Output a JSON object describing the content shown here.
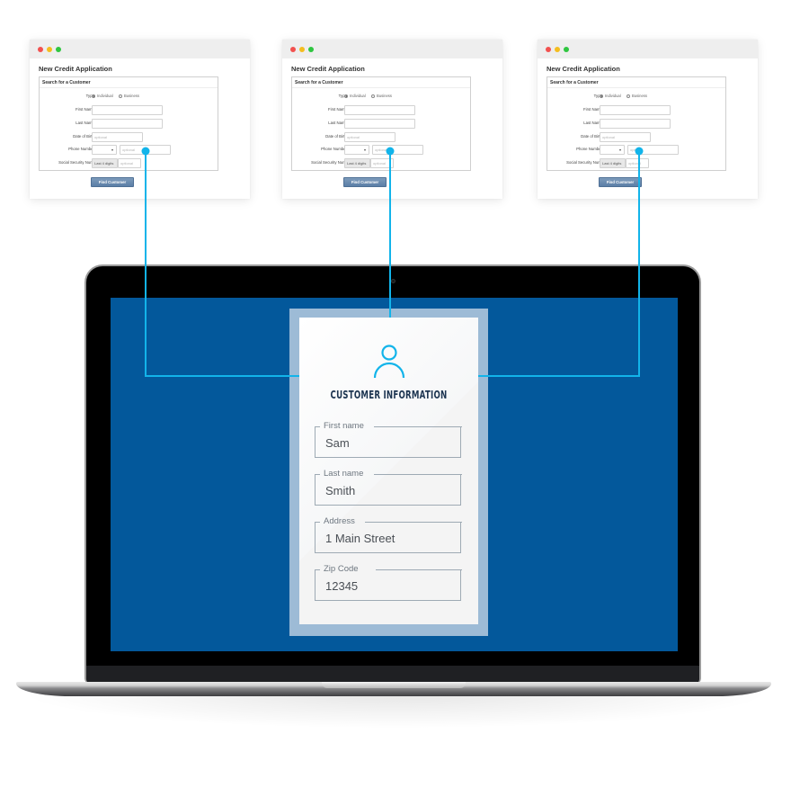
{
  "colors": {
    "accent": "#12b4ea",
    "screen": "#03589b",
    "card_frame": "#9dbbd6",
    "title": "#1c3450"
  },
  "windows": [
    {
      "traffic_lights": [
        "close",
        "minimize",
        "maximize"
      ],
      "title": "New Credit Application",
      "section": "Search for a Customer",
      "type_label": "Type",
      "type_options": [
        "Individual",
        "Business"
      ],
      "type_selected": "Individual",
      "fields": {
        "first_name": "First Name",
        "last_name": "Last Name",
        "dob": "Date of Birth",
        "phone": "Phone Number",
        "ssn": "Social Security Num."
      },
      "placeholders": {
        "dob": "optional",
        "phone": "optional",
        "ssn": "optional"
      },
      "ssn_addon": "Last 4 digits",
      "button": "Find Customer"
    },
    {
      "traffic_lights": [
        "close",
        "minimize",
        "maximize"
      ],
      "title": "New Credit Application",
      "section": "Search for a Customer",
      "type_label": "Type",
      "type_options": [
        "Individual",
        "Business"
      ],
      "type_selected": "Individual",
      "fields": {
        "first_name": "First Name",
        "last_name": "Last Name",
        "dob": "Date of Birth",
        "phone": "Phone Number",
        "ssn": "Social Security Num."
      },
      "placeholders": {
        "dob": "optional",
        "phone": "optional",
        "ssn": "optional"
      },
      "ssn_addon": "Last 4 digits",
      "button": "Find Customer"
    },
    {
      "traffic_lights": [
        "close",
        "minimize",
        "maximize"
      ],
      "title": "New Credit Application",
      "section": "Search for a Customer",
      "type_label": "Type",
      "type_options": [
        "Individual",
        "Business"
      ],
      "type_selected": "Individual",
      "fields": {
        "first_name": "First Name",
        "last_name": "Last Name",
        "dob": "Date of Birth",
        "phone": "Phone Number",
        "ssn": "Social Security Num."
      },
      "placeholders": {
        "dob": "optional",
        "phone": "optional",
        "ssn": "optional"
      },
      "ssn_addon": "Last 4 digits",
      "button": "Find Customer"
    }
  ],
  "card": {
    "icon": "person-icon",
    "title": "CUSTOMER INFORMATION",
    "fields": [
      {
        "label": "First name",
        "value": "Sam"
      },
      {
        "label": "Last name",
        "value": "Smith"
      },
      {
        "label": "Address",
        "value": "1 Main Street"
      },
      {
        "label": "Zip Code",
        "value": "12345"
      }
    ]
  }
}
